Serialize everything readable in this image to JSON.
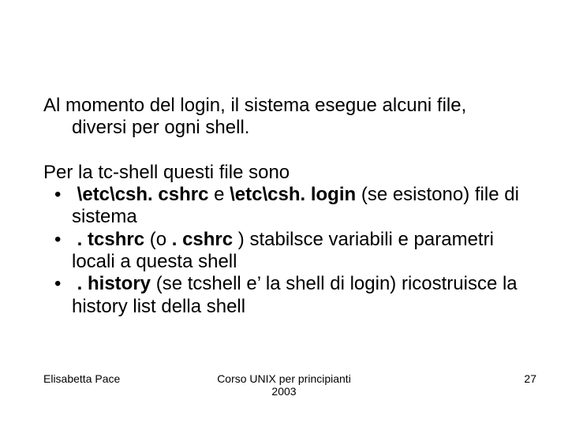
{
  "slide": {
    "para1": "Al momento del login, il sistema esegue alcuni file, diversi per ogni shell.",
    "para2_intro": "Per la tc-shell questi file sono",
    "bullets": [
      {
        "pre": "",
        "bold1": "\\etc\\csh. cshrc",
        "mid1": " e ",
        "bold2": "\\etc\\csh. login",
        "post": " (se esistono) file di sistema"
      },
      {
        "pre": " ",
        "bold1": ". tcshrc",
        "mid1": " (o ",
        "bold2": ". cshrc",
        "post": " ) stabilsce variabili e parametri locali a questa shell"
      },
      {
        "pre": " ",
        "bold1": ". history",
        "mid1": "",
        "bold2": "",
        "post": "  (se tcshell e’ la shell di login) ricostruisce la history list della shell"
      }
    ]
  },
  "footer": {
    "author": "Elisabetta Pace",
    "course_line1": "Corso UNIX per principianti",
    "course_line2": "2003",
    "page": "27"
  }
}
